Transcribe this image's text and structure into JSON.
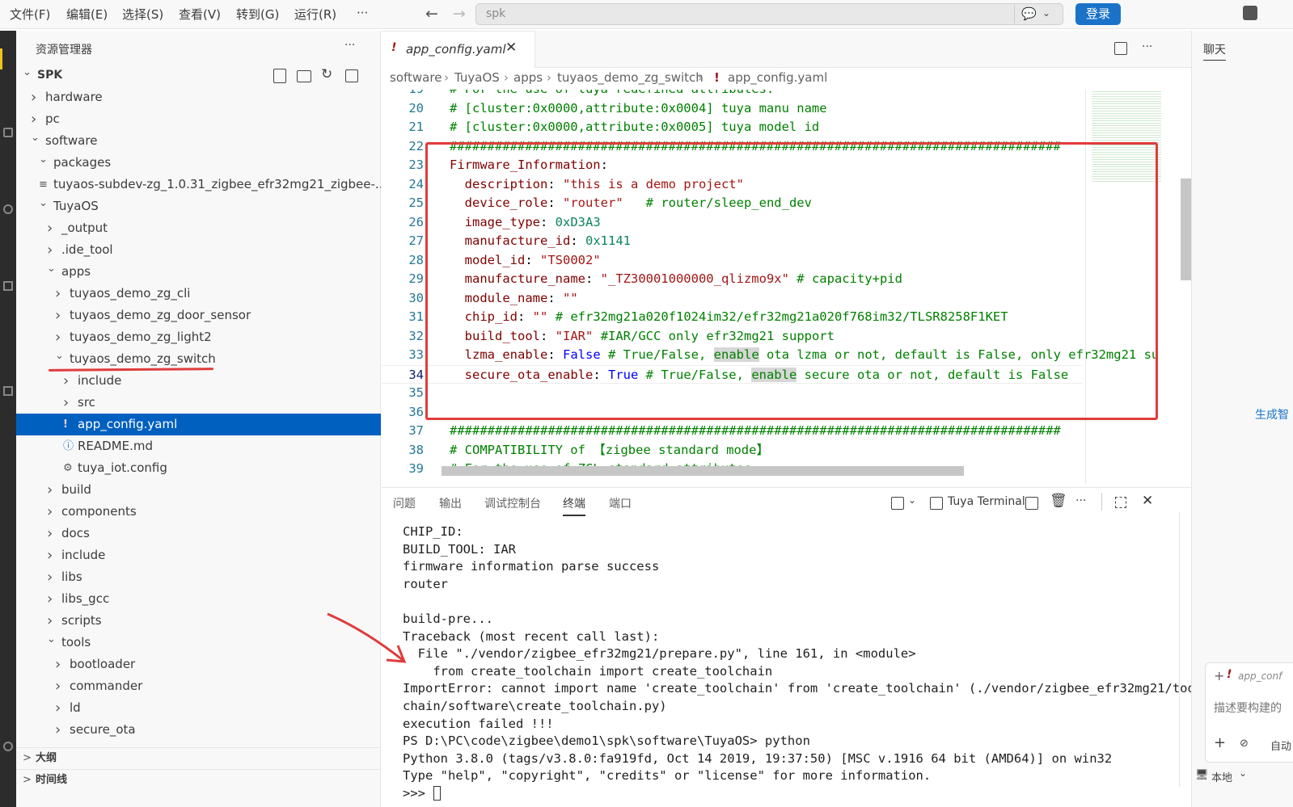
{
  "menu": [
    "文件(F)",
    "编辑(E)",
    "选择(S)",
    "查看(V)",
    "转到(G)",
    "运行(R)",
    "···"
  ],
  "search": {
    "placeholder": "spk"
  },
  "login_label": "登录",
  "sidebar": {
    "title": "资源管理器",
    "more": "···",
    "tree": [
      {
        "label": "SPK",
        "chev": "v",
        "depth": 0,
        "bold": true
      },
      {
        "label": "hardware",
        "chev": ">",
        "depth": 1
      },
      {
        "label": "pc",
        "chev": ">",
        "depth": 1
      },
      {
        "label": "software",
        "chev": "v",
        "depth": 1
      },
      {
        "label": "packages",
        "chev": "v",
        "depth": 2
      },
      {
        "label": "tuyaos-subdev-zg_1.0.31_zigbee_efr32mg21_zigbee-...",
        "chev": "",
        "depth": 2,
        "icon": "file"
      },
      {
        "label": "TuyaOS",
        "chev": "v",
        "depth": 2
      },
      {
        "label": "_output",
        "chev": ">",
        "depth": 3
      },
      {
        "label": ".ide_tool",
        "chev": ">",
        "depth": 3
      },
      {
        "label": "apps",
        "chev": "v",
        "depth": 3
      },
      {
        "label": "tuyaos_demo_zg_cli",
        "chev": ">",
        "depth": 4
      },
      {
        "label": "tuyaos_demo_zg_door_sensor",
        "chev": ">",
        "depth": 4
      },
      {
        "label": "tuyaos_demo_zg_light2",
        "chev": ">",
        "depth": 4
      },
      {
        "label": "tuyaos_demo_zg_switch",
        "chev": "v",
        "depth": 4
      },
      {
        "label": "include",
        "chev": ">",
        "depth": 5
      },
      {
        "label": "src",
        "chev": ">",
        "depth": 5
      },
      {
        "label": "app_config.yaml",
        "chev": "!",
        "depth": 5,
        "selected": true
      },
      {
        "label": "README.md",
        "chev": "ⓘ",
        "depth": 5
      },
      {
        "label": "tuya_iot.config",
        "chev": "⚙",
        "depth": 5
      },
      {
        "label": "build",
        "chev": ">",
        "depth": 3
      },
      {
        "label": "components",
        "chev": ">",
        "depth": 3
      },
      {
        "label": "docs",
        "chev": ">",
        "depth": 3
      },
      {
        "label": "include",
        "chev": ">",
        "depth": 3
      },
      {
        "label": "libs",
        "chev": ">",
        "depth": 3
      },
      {
        "label": "libs_gcc",
        "chev": ">",
        "depth": 3
      },
      {
        "label": "scripts",
        "chev": ">",
        "depth": 3
      },
      {
        "label": "tools",
        "chev": "v",
        "depth": 3
      },
      {
        "label": "bootloader",
        "chev": ">",
        "depth": 4
      },
      {
        "label": "commander",
        "chev": ">",
        "depth": 4
      },
      {
        "label": "ld",
        "chev": ">",
        "depth": 4
      },
      {
        "label": "secure_ota",
        "chev": ">",
        "depth": 4
      }
    ],
    "outline": "大纲",
    "timeline": "时间线"
  },
  "editor": {
    "tab_label": "app_config.yaml",
    "breadcrumb": [
      "software",
      "TuyaOS",
      "apps",
      "tuyaos_demo_zg_switch",
      "app_config.yaml"
    ],
    "lines": [
      {
        "n": "19",
        "segs": [
          [
            "c-com",
            "# For the use of tuya redefined attributes:"
          ]
        ]
      },
      {
        "n": "20",
        "segs": [
          [
            "c-com",
            "# [cluster:0x0000,attribute:0x0004] tuya manu name"
          ]
        ]
      },
      {
        "n": "21",
        "segs": [
          [
            "c-com",
            "# [cluster:0x0000,attribute:0x0005] tuya model id"
          ]
        ]
      },
      {
        "n": "22",
        "segs": [
          [
            "c-com",
            "#################################################################################"
          ]
        ]
      },
      {
        "n": "23",
        "segs": [
          [
            "c-key",
            "Firmware_Information"
          ],
          [
            "c-def",
            ":"
          ]
        ]
      },
      {
        "n": "24",
        "segs": [
          [
            "c-def",
            "  "
          ],
          [
            "c-key",
            "description"
          ],
          [
            "c-def",
            ": "
          ],
          [
            "c-str",
            "\"this is a demo project\""
          ]
        ]
      },
      {
        "n": "25",
        "segs": [
          [
            "c-def",
            "  "
          ],
          [
            "c-key",
            "device_role"
          ],
          [
            "c-def",
            ": "
          ],
          [
            "c-str",
            "\"router\""
          ],
          [
            "c-def",
            "   "
          ],
          [
            "c-com",
            "# router/sleep_end_dev"
          ]
        ]
      },
      {
        "n": "26",
        "segs": [
          [
            "c-def",
            "  "
          ],
          [
            "c-key",
            "image_type"
          ],
          [
            "c-def",
            ": "
          ],
          [
            "c-num",
            "0xD3A3"
          ]
        ]
      },
      {
        "n": "27",
        "segs": [
          [
            "c-def",
            "  "
          ],
          [
            "c-key",
            "manufacture_id"
          ],
          [
            "c-def",
            ": "
          ],
          [
            "c-num",
            "0x1141"
          ]
        ]
      },
      {
        "n": "28",
        "segs": [
          [
            "c-def",
            "  "
          ],
          [
            "c-key",
            "model_id"
          ],
          [
            "c-def",
            ": "
          ],
          [
            "c-str",
            "\"TS0002\""
          ]
        ]
      },
      {
        "n": "29",
        "segs": [
          [
            "c-def",
            "  "
          ],
          [
            "c-key",
            "manufacture_name"
          ],
          [
            "c-def",
            ": "
          ],
          [
            "c-str",
            "\"_TZ30001000000_qlizmo9x\""
          ],
          [
            "c-def",
            " "
          ],
          [
            "c-com",
            "# capacity+pid"
          ]
        ]
      },
      {
        "n": "30",
        "segs": [
          [
            "c-def",
            "  "
          ],
          [
            "c-key",
            "module_name"
          ],
          [
            "c-def",
            ": "
          ],
          [
            "c-str",
            "\"\""
          ]
        ]
      },
      {
        "n": "31",
        "segs": [
          [
            "c-def",
            "  "
          ],
          [
            "c-key",
            "chip_id"
          ],
          [
            "c-def",
            ": "
          ],
          [
            "c-str",
            "\"\""
          ],
          [
            "c-def",
            " "
          ],
          [
            "c-com",
            "# efr32mg21a020f1024im32/efr32mg21a020f768im32/TLSR8258F1KET"
          ]
        ]
      },
      {
        "n": "32",
        "segs": [
          [
            "c-def",
            "  "
          ],
          [
            "c-key",
            "build_tool"
          ],
          [
            "c-def",
            ": "
          ],
          [
            "c-str",
            "\"IAR\""
          ],
          [
            "c-def",
            " "
          ],
          [
            "c-com",
            "#IAR/GCC only efr32mg21 support"
          ]
        ]
      },
      {
        "n": "33",
        "segs": [
          [
            "c-def",
            "  "
          ],
          [
            "c-key",
            "lzma_enable"
          ],
          [
            "c-def",
            ": "
          ],
          [
            "c-kw",
            "False"
          ],
          [
            "c-def",
            " "
          ],
          [
            "c-com",
            "# True/False, "
          ],
          [
            "c-com hl",
            "enable"
          ],
          [
            "c-com",
            " ota lzma or not, default is False, only efr32mg21 su"
          ]
        ]
      },
      {
        "n": "34",
        "segs": [
          [
            "c-def",
            "  "
          ],
          [
            "c-key",
            "secure_ota_enable"
          ],
          [
            "c-def",
            ": "
          ],
          [
            "c-kw",
            "True"
          ],
          [
            "c-def",
            " "
          ],
          [
            "c-com",
            "# True/False, "
          ],
          [
            "c-com hl",
            "enable"
          ],
          [
            "c-com",
            " secure ota or not, default is False"
          ]
        ]
      },
      {
        "n": "35",
        "segs": []
      },
      {
        "n": "36",
        "segs": []
      },
      {
        "n": "37",
        "segs": [
          [
            "c-com",
            "#################################################################################"
          ]
        ]
      },
      {
        "n": "38",
        "segs": [
          [
            "c-com",
            "# COMPATIBILITY of 【zigbee standard mode】"
          ]
        ]
      },
      {
        "n": "39",
        "segs": [
          [
            "c-com",
            "# For the use of ZCL standard attributes:"
          ]
        ]
      }
    ]
  },
  "panel": {
    "tabs": [
      "问题",
      "输出",
      "调试控制台",
      "终端",
      "端口"
    ],
    "active_tab": "终端",
    "terminal_name": "Tuya Terminal",
    "terminal": [
      "CHIP_ID:",
      "BUILD_TOOL: IAR",
      "firmware information parse success",
      "router",
      "",
      "build-pre...",
      "Traceback (most recent call last):",
      "  File \"./vendor/zigbee_efr32mg21/prepare.py\", line 161, in <module>",
      "    from create_toolchain import create_toolchain",
      "ImportError: cannot import name 'create_toolchain' from 'create_toolchain' (./vendor/zigbee_efr32mg21/tool",
      "chain/software\\create_toolchain.py)",
      "execution failed !!!",
      "PS D:\\PC\\code\\zigbee\\demo1\\spk\\software\\TuyaOS> python",
      "Python 3.8.0 (tags/v3.8.0:fa919fd, Oct 14 2019, 19:37:50) [MSC v.1916 64 bit (AMD64)] on win32",
      "Type \"help\", \"copyright\", \"credits\" or \"license\" for more information.",
      ">>> "
    ]
  },
  "right": {
    "tab_label": "聊天",
    "link": "生成智",
    "chat_file": "app_conf",
    "chat_placeholder": "描述要构建的",
    "auto": "自动",
    "local": "本地"
  },
  "colors": {
    "accent": "#1a73c9",
    "selection": "#0060c0",
    "annotation": "#e03c3c"
  }
}
